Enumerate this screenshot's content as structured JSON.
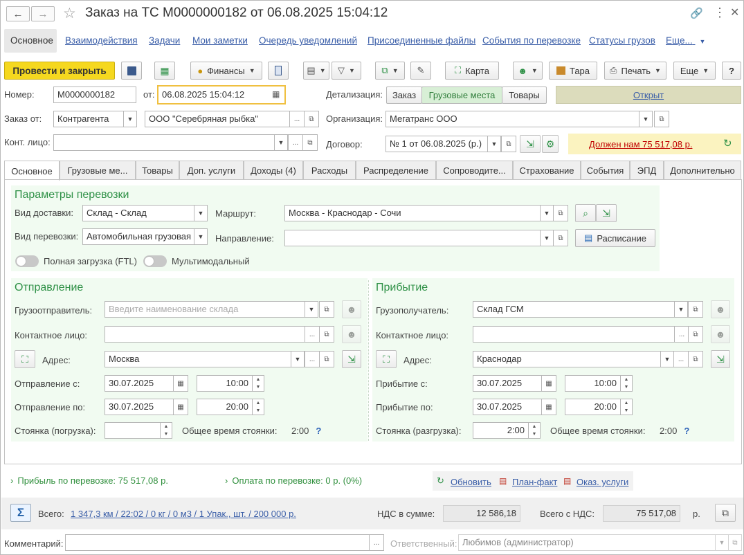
{
  "window": {
    "title": "Заказ на ТС М0000000182 от 06.08.2025 15:04:12"
  },
  "top_tabs": [
    "Основное",
    "Взаимодействия",
    "Задачи",
    "Мои заметки",
    "Очередь уведомлений",
    "Присоединенные файлы",
    "События по перевозке",
    "Статусы грузов",
    "Еще..."
  ],
  "toolbar": {
    "post_close": "Провести и закрыть",
    "finance": "Финансы",
    "map": "Карта",
    "tara": "Тара",
    "print": "Печать",
    "more": "Еще",
    "help": "?"
  },
  "header": {
    "number_label": "Номер:",
    "number": "М0000000182",
    "from_label": "от:",
    "date": "06.08.2025 15:04:12",
    "detail_label": "Детализация:",
    "detail_options": [
      "Заказ",
      "Грузовые места",
      "Товары"
    ],
    "status": "Открыт",
    "order_from_label": "Заказ от:",
    "order_from_type": "Контрагента",
    "counterparty": "ООО \"Серебряная рыбка\"",
    "organization_label": "Организация:",
    "organization": "Мегатранс ООО",
    "contact_label": "Конт. лицо:",
    "contract_label": "Договор:",
    "contract": "№ 1 от 06.08.2025 (р.)",
    "debt": "Должен нам 75 517,08 р."
  },
  "tabs": [
    "Основное",
    "Грузовые ме...",
    "Товары",
    "Доп. услуги",
    "Доходы (4)",
    "Расходы",
    "Распределение",
    "Сопроводите...",
    "Страхование",
    "События",
    "ЭПД",
    "Дополнительно"
  ],
  "params": {
    "title": "Параметры перевозки",
    "delivery_label": "Вид доставки:",
    "delivery": "Склад - Склад",
    "route_label": "Маршрут:",
    "route": "Москва - Краснодар - Сочи",
    "transport_label": "Вид перевозки:",
    "transport": "Автомобильная грузовая",
    "direction_label": "Направление:",
    "schedule": "Расписание",
    "ftl": "Полная загрузка (FTL)",
    "multimodal": "Мультимодальный"
  },
  "departure": {
    "title": "Отправление",
    "shipper_label": "Грузоотправитель:",
    "shipper_placeholder": "Введите наименование склада",
    "contact_label": "Контактное лицо:",
    "address_label": "Адрес:",
    "address": "Москва",
    "from_label": "Отправление с:",
    "from_date": "30.07.2025",
    "from_time": "10:00",
    "to_label": "Отправление по:",
    "to_date": "30.07.2025",
    "to_time": "20:00",
    "stay_label": "Стоянка (погрузка):",
    "total_stay_label": "Общее время стоянки:",
    "total_stay": "2:00",
    "q": "?"
  },
  "arrival": {
    "title": "Прибытие",
    "consignee_label": "Грузополучатель:",
    "consignee": "Склад ГСМ",
    "contact_label": "Контактное лицо:",
    "address_label": "Адрес:",
    "address": "Краснодар",
    "from_label": "Прибытие с:",
    "from_date": "30.07.2025",
    "from_time": "10:00",
    "to_label": "Прибытие по:",
    "to_date": "30.07.2025",
    "to_time": "20:00",
    "stay_label": "Стоянка (разгрузка):",
    "stay": "2:00",
    "total_stay_label": "Общее время стоянки:",
    "total_stay": "2:00",
    "q": "?"
  },
  "summary": {
    "profit": "Прибыль по перевозке: 75 517,08 р.",
    "payment": "Оплата по перевозке: 0 р. (0%)",
    "refresh": "Обновить",
    "planfact": "План-факт",
    "services": "Оказ. услуги"
  },
  "totals": {
    "sigma": "Σ",
    "total_label": "Всего:",
    "total_value": "1 347,3 км / 22:02 / 0 кг / 0 м3 / 1 Упак., шт. / 200 000 р.",
    "vat_label": "НДС в сумме:",
    "vat": "12 586,18",
    "total_vat_label": "Всего с НДС:",
    "total_vat": "75 517,08",
    "currency": "р."
  },
  "footer": {
    "comment_label": "Комментарий:",
    "responsible_label": "Ответственный:",
    "responsible": "Любимов (администратор)"
  },
  "colors": {
    "accent": "#f5d81f",
    "green": "#2f9147",
    "link": "#3a5ea8",
    "debt": "#c00000",
    "panel": "#f1fbf1"
  }
}
